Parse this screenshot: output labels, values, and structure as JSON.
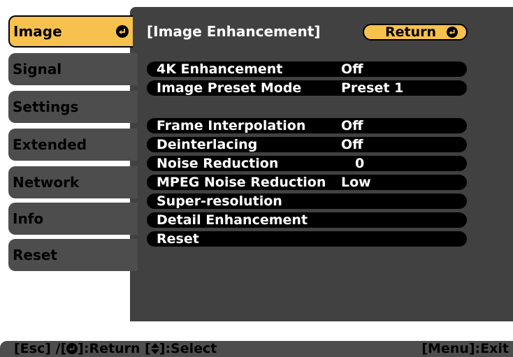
{
  "tabs": [
    {
      "label": "Image",
      "active": true
    },
    {
      "label": "Signal"
    },
    {
      "label": "Settings"
    },
    {
      "label": "Extended"
    },
    {
      "label": "Network"
    },
    {
      "label": "Info"
    },
    {
      "label": "Reset"
    }
  ],
  "header": {
    "title": "[Image Enhancement]",
    "return_label": "Return"
  },
  "items": [
    {
      "name": "4K Enhancement",
      "value": "Off"
    },
    {
      "name": "Image Preset Mode",
      "value": "Preset 1"
    },
    {
      "name": "Frame Interpolation",
      "value": "Off"
    },
    {
      "name": "Deinterlacing",
      "value": "Off"
    },
    {
      "name": "Noise Reduction",
      "value": "0"
    },
    {
      "name": "MPEG Noise Reduction",
      "value": "Low"
    },
    {
      "name": "Super-resolution",
      "value": ""
    },
    {
      "name": "Detail Enhancement",
      "value": ""
    },
    {
      "name": "Reset",
      "value": ""
    }
  ],
  "footer": {
    "esc_part": "[Esc] /[",
    "return_part": "]:Return  [",
    "select_part": "]:Select",
    "exit": "[Menu]:Exit"
  },
  "colors": {
    "accent": "#f7c14d",
    "panel": "#414141",
    "tab": "#4d4d4d",
    "row": "#000000"
  },
  "icons": [
    "enter-icon",
    "updown-arrow-icon"
  ]
}
